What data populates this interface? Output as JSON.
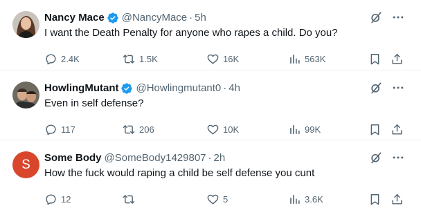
{
  "colors": {
    "verified_blue": "#1d9bf0",
    "text_primary": "#0f1419",
    "text_secondary": "#536471",
    "avatar_letter_bg": "#d8472c"
  },
  "tweets": [
    {
      "name": "Nancy Mace",
      "verified": true,
      "handle": "@NancyMace",
      "separator": "·",
      "time": "5h",
      "text": "I want the Death Penalty for anyone who rapes a child. Do you?",
      "replies": "2.4K",
      "retweets": "1.5K",
      "likes": "16K",
      "views": "563K",
      "avatar_icon": "profile-photo"
    },
    {
      "name": "HowlingMutant",
      "verified": true,
      "handle": "@Howlingmutant0",
      "separator": "·",
      "time": "4h",
      "text": "Even in self defense?",
      "replies": "117",
      "retweets": "206",
      "likes": "10K",
      "views": "99K",
      "avatar_icon": "profile-photo"
    },
    {
      "name": "Some Body",
      "verified": false,
      "handle": "@SomeBody1429807",
      "separator": "·",
      "time": "2h",
      "text": "How the fuck would raping a child be self defense you cunt",
      "replies": "12",
      "retweets": "",
      "likes": "5",
      "views": "3.6K",
      "avatar_letter": "S"
    }
  ]
}
